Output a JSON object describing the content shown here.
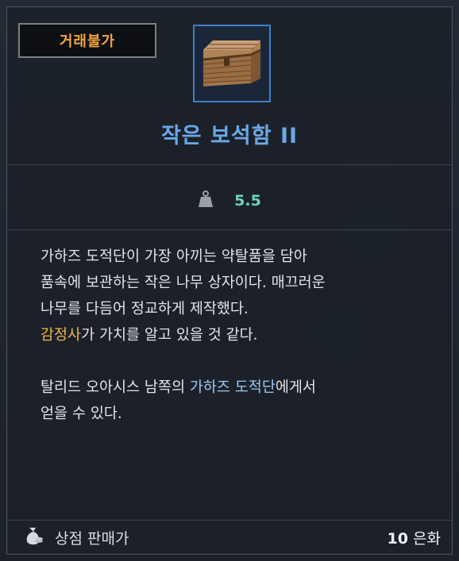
{
  "tooltip": {
    "trade_badge": "거래불가",
    "item_icon": "wooden-treasure-chest-icon",
    "item_name": "작은 보석함 II",
    "weight": {
      "icon": "weight-icon",
      "value": "5.5"
    },
    "description": {
      "line1": "가하즈 도적단이 가장 아끼는 약탈품을 담아",
      "line2": "품속에 보관하는 작은 나무 상자이다. 매끄러운",
      "line3": "나무를 다듬어 정교하게 제작했다.",
      "line4_highlight": "감정사",
      "line4_rest": "가 가치를 알고 있을 것 같다.",
      "line5_pre": "탈리드 오아시스 남쪽의 ",
      "line5_highlight": "가하즈 도적단",
      "line5_post": "에게서",
      "line6": "얻을 수 있다."
    },
    "footer": {
      "icon": "money-bag-icon",
      "label": "상점 판매가",
      "price_number": "10",
      "price_unit": " 은화"
    }
  },
  "colors": {
    "badge_text": "#f0a43a",
    "item_name": "#6aa8e6",
    "weight_value": "#6ed7b8",
    "highlight_gold": "#f0b64a",
    "highlight_blue": "#9fc7f5",
    "icon_frame_border": "#3d7fc9"
  }
}
